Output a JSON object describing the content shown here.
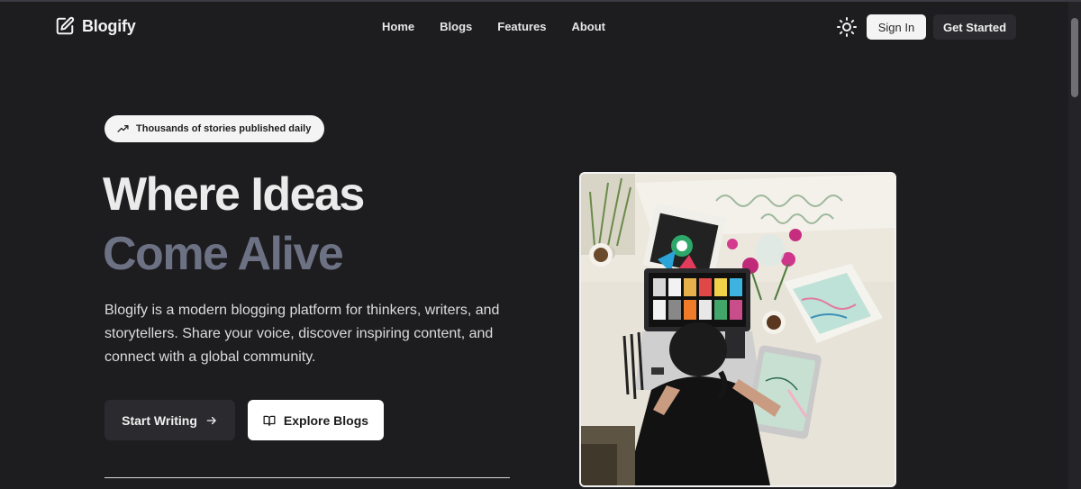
{
  "brand": {
    "name": "Blogify",
    "logo_icon": "edit-square-icon"
  },
  "nav": {
    "links": [
      "Home",
      "Blogs",
      "Features",
      "About"
    ],
    "theme_icon": "sun-icon",
    "sign_in_label": "Sign In",
    "get_started_label": "Get Started"
  },
  "hero": {
    "badge_icon": "trending-up-icon",
    "badge_text": "Thousands of stories published daily",
    "headline_line1": "Where Ideas",
    "headline_line2": "Come Alive",
    "description": "Blogify is a modern blogging platform for thinkers, writers, and storytellers. Share your voice, discover inspiring content, and connect with a global community.",
    "primary_cta": {
      "label": "Start Writing",
      "icon": "arrow-right-icon"
    },
    "secondary_cta": {
      "label": "Explore Blogs",
      "icon": "open-book-icon"
    },
    "image_alt": "person-drawing-at-desk-photo"
  },
  "colors": {
    "background": "#1d1c1f",
    "headline_primary": "#ebebeb",
    "headline_accent": "#6c7184",
    "button_dark": "#2b2a2e",
    "button_light": "#ffffff"
  }
}
